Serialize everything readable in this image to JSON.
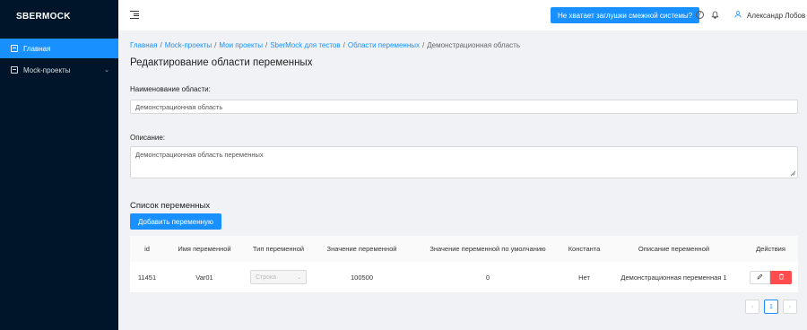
{
  "sidebar": {
    "logo": "SBERMOCK",
    "items": [
      {
        "label": "Главная",
        "icon": "dashboard-icon",
        "active": true
      },
      {
        "label": "Mock-проекты",
        "icon": "projects-icon",
        "expandable": true
      }
    ]
  },
  "header": {
    "fold_icon": "menu-fold-icon",
    "alert_button": "Не хватает заглушки смежной системы?",
    "help_icon": "question-circle-icon",
    "bell_icon": "bell-icon",
    "user_name": "Александр Лобов",
    "user_icon": "user-icon"
  },
  "breadcrumb": {
    "items": [
      "Главная",
      "Mock-проекты",
      "Мои проекты",
      "SberMock для тестов",
      "Области переменных"
    ],
    "current": "Демонстрационная область",
    "separator": "/"
  },
  "page_title": "Редактирование области переменных",
  "form": {
    "name_label": "Наименование области:",
    "name_value": "Демонстрационная область",
    "description_label": "Описание:",
    "description_value": "Демонстрационная область переменных"
  },
  "variables": {
    "section_title": "Список переменных",
    "add_button": "Добавить переменную",
    "columns": [
      "id",
      "Имя переменной",
      "Тип переменной",
      "Значение переменной",
      "Значение переменной по умолчанию",
      "Константа",
      "Описание переменной",
      "Действия"
    ],
    "rows": [
      {
        "id": "11451",
        "name": "Var01",
        "type": "Строка",
        "value": "100500",
        "default_value": "0",
        "constant": "Нет",
        "description": "Демонстрационная переменная 1"
      }
    ]
  },
  "pagination": {
    "prev": "‹",
    "current_page": "1",
    "next": "›"
  },
  "colors": {
    "sidebar_bg": "#001529",
    "accent": "#1890ff",
    "danger": "#ff4d4f",
    "page_bg": "#f0f2f5"
  }
}
